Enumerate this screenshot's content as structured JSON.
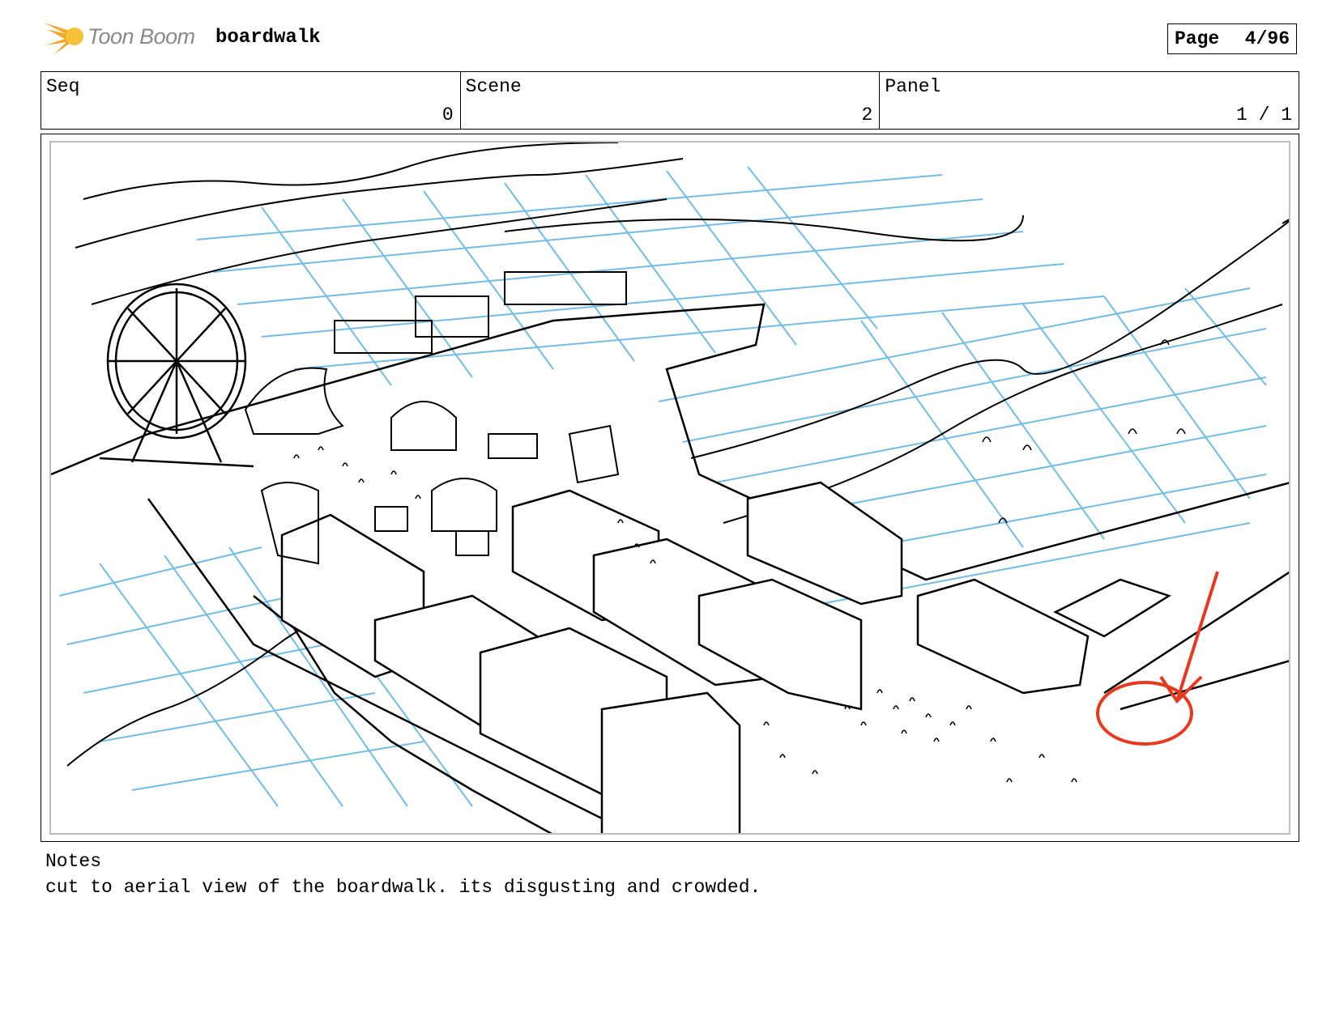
{
  "header": {
    "logo_text": "Toon Boom",
    "project_title": "boardwalk",
    "page_label": "Page",
    "page_number": "4/96"
  },
  "fields": {
    "seq": {
      "label": "Seq",
      "value": "0"
    },
    "scene": {
      "label": "Scene",
      "value": "2"
    },
    "panel": {
      "label": "Panel",
      "value": "1 / 1"
    }
  },
  "panel_image": {
    "subject": "aerial sketch of boardwalk pier with ferris wheel, tents, stalls, crowds, ocean grid",
    "annotation_color": "#e8391f",
    "grid_color": "#6fbde8"
  },
  "notes": {
    "label": "Notes",
    "text": "cut to aerial view of the boardwalk. its disgusting and crowded."
  },
  "colors": {
    "logo_orange": "#f5a623",
    "logo_text": "#8a8a8a"
  }
}
